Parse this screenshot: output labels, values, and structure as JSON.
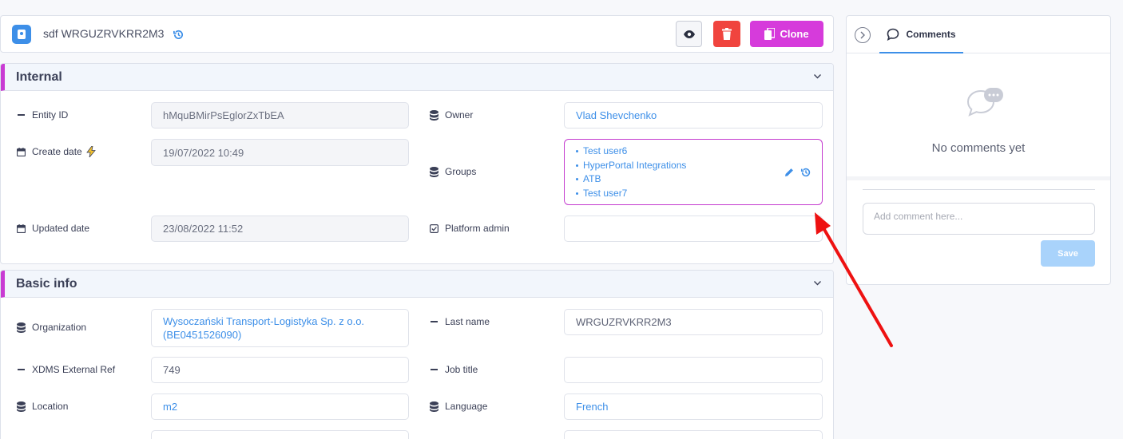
{
  "header": {
    "title": "sdf WRGUZRVKRR2M3",
    "clone_label": "Clone"
  },
  "internal": {
    "title": "Internal",
    "entity_id_label": "Entity ID",
    "entity_id_value": "hMquBMirPsEglorZxTbEA",
    "owner_label": "Owner",
    "owner_value": "Vlad Shevchenko",
    "create_date_label": "Create date",
    "create_date_value": "19/07/2022 10:49",
    "groups_label": "Groups",
    "groups": [
      "Test user6",
      "HyperPortal Integrations",
      "ATB",
      "Test user7"
    ],
    "updated_date_label": "Updated date",
    "updated_date_value": "23/08/2022 11:52",
    "platform_admin_label": "Platform admin",
    "platform_admin_value": ""
  },
  "basic_info": {
    "title": "Basic info",
    "organization_label": "Organization",
    "organization_value_line1": "Wysoczański Transport-Logistyka Sp. z o.o.",
    "organization_value_line2": "(BE0451526090)",
    "last_name_label": "Last name",
    "last_name_value": "WRGUZRVKRR2M3",
    "xdms_label": "XDMS External Ref",
    "xdms_value": "749",
    "job_title_label": "Job title",
    "job_title_value": "",
    "location_label": "Location",
    "location_value": "m2",
    "language_label": "Language",
    "language_value": "French"
  },
  "comments": {
    "tab_label": "Comments",
    "empty_text": "No comments yet",
    "input_placeholder": "Add comment here...",
    "save_label": "Save"
  },
  "colors": {
    "accent": "#3d8fe8",
    "danger": "#f0443e",
    "clone": "#d63bdb",
    "section_marker": "#c93bd3",
    "annotation_arrow": "#ee1111"
  },
  "icons": [
    "contact-card-icon",
    "history-icon",
    "eye-icon",
    "trash-icon",
    "copy-icon",
    "chevron-down-icon",
    "calendar-icon",
    "lightning-icon",
    "database-icon",
    "checkbox-icon",
    "pencil-icon",
    "chevron-right-icon",
    "comment-icon",
    "chat-bubbles-icon"
  ]
}
